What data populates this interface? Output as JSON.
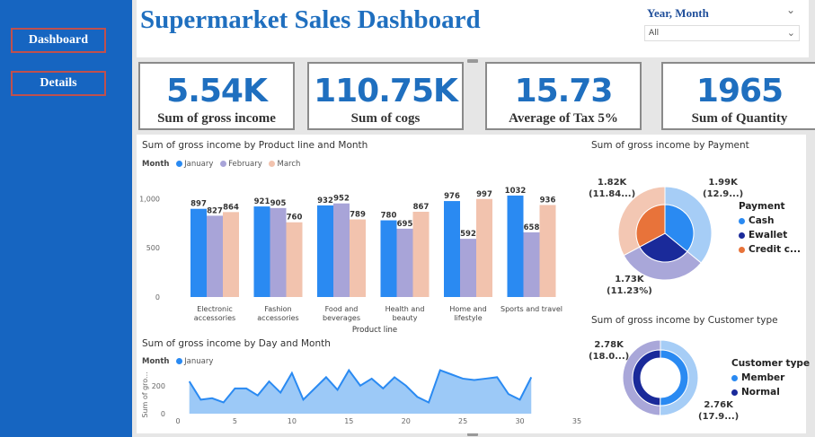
{
  "nav": {
    "dashboard": "Dashboard",
    "details": "Details"
  },
  "title": "Supermarket Sales Dashboard",
  "slicer": {
    "label": "Year, Month",
    "value": "All"
  },
  "kpis": [
    {
      "value": "5.54K",
      "label": "Sum of gross income"
    },
    {
      "value": "110.75K",
      "label": "Sum of cogs"
    },
    {
      "value": "15.73",
      "label": "Average of Tax 5%"
    },
    {
      "value": "1965",
      "label": "Sum of Quantity"
    }
  ],
  "colors": {
    "january": "#2a8af2",
    "february": "#a8a4d8",
    "march": "#f2c3ae",
    "cash": "#2a8af2",
    "ewallet": "#1a2a9a",
    "credit": "#e8733a",
    "member": "#2a8af2",
    "normal": "#1a2a9a"
  },
  "chart_data": [
    {
      "type": "bar",
      "title": "Sum of gross income by Product line and Month",
      "legend_title": "Month",
      "xlabel": "Product line",
      "ylabel": "",
      "categories": [
        "Electronic accessories",
        "Fashion accessories",
        "Food and beverages",
        "Health and beauty",
        "Home and lifestyle",
        "Sports and travel"
      ],
      "category_lines": [
        [
          "Electronic",
          "accessories"
        ],
        [
          "Fashion",
          "accessories"
        ],
        [
          "Food and",
          "beverages"
        ],
        [
          "Health and",
          "beauty"
        ],
        [
          "Home and",
          "lifestyle"
        ],
        [
          "Sports and travel"
        ]
      ],
      "series": [
        {
          "name": "January",
          "values": [
            897,
            921,
            932,
            780,
            976,
            1032
          ]
        },
        {
          "name": "February",
          "values": [
            827,
            905,
            952,
            695,
            592,
            658
          ]
        },
        {
          "name": "March",
          "values": [
            864,
            760,
            789,
            867,
            997,
            936
          ]
        }
      ],
      "ylim": [
        0,
        1150
      ],
      "yticks": [
        "0",
        "500",
        "1,000"
      ],
      "grid": false
    },
    {
      "type": "area",
      "title": "Sum of gross income by Day and Month",
      "legend_title": "Month",
      "ylabel": "Sum of gro...",
      "series": [
        {
          "name": "January",
          "x": [
            1,
            2,
            3,
            4,
            5,
            6,
            7,
            8,
            9,
            10,
            11,
            12,
            13,
            14,
            15,
            16,
            17,
            18,
            19,
            20,
            21,
            22,
            23,
            24,
            25,
            26,
            27,
            28,
            29,
            30,
            31
          ],
          "values": [
            230,
            100,
            110,
            80,
            180,
            180,
            130,
            230,
            150,
            290,
            100,
            180,
            260,
            170,
            310,
            200,
            250,
            180,
            260,
            200,
            120,
            80,
            310,
            280,
            250,
            240,
            250,
            260,
            140,
            100,
            260
          ]
        }
      ],
      "xlim": [
        0,
        35
      ],
      "xticks": [
        "0",
        "5",
        "10",
        "15",
        "20",
        "25",
        "30",
        "35"
      ],
      "yticks": [
        "0",
        "200"
      ],
      "ylim": [
        0,
        320
      ]
    },
    {
      "type": "pie",
      "title": "Sum of gross income by Payment",
      "legend_title": "Payment",
      "labels": [
        "Cash",
        "Ewallet",
        "Credit c..."
      ],
      "values": [
        1.99,
        1.73,
        1.82
      ],
      "data_labels": [
        [
          "1.99K",
          "(12.9...)"
        ],
        [
          "1.73K",
          "(11.23%)"
        ],
        [
          "1.82K",
          "(11.84...)"
        ]
      ]
    },
    {
      "type": "pie",
      "title": "Sum of gross income by Customer type",
      "legend_title": "Customer type",
      "labels": [
        "Member",
        "Normal"
      ],
      "values": [
        2.78,
        2.76
      ],
      "data_labels": [
        [
          "2.78K",
          "(18.0...)"
        ],
        [
          "2.76K",
          "(17.9...)"
        ]
      ]
    }
  ]
}
